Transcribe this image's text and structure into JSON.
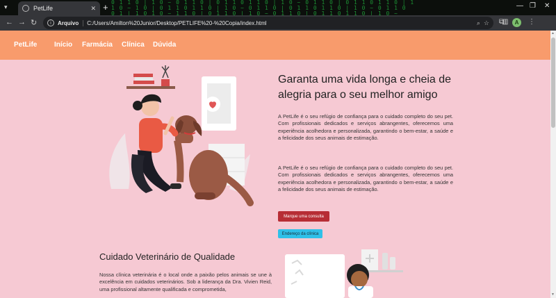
{
  "browser": {
    "tab_title": "PetLife",
    "url_chip": "Arquivo",
    "url": "C:/Users/Amilton%20Junior/Desktop/PETLIFE%20-%20Copia/index.html"
  },
  "site": {
    "brand": "PetLife",
    "nav": [
      "Início",
      "Farmácia",
      "Clínica",
      "Dúvida"
    ],
    "nav_color": "#f89b6c",
    "bg_color": "#f6c9d3"
  },
  "hero": {
    "title": "Garanta uma vida longa e cheia de alegria para o seu melhor amigo",
    "paragraph_1": "A PetLife é o seu refúgio de confiança para o cuidado completo do seu pet. Com profissionais dedicados e serviços abrangentes, oferecemos uma experiência acolhedora e personalizada, garantindo o bem-estar, a saúde e a felicidade dos seus animais de estimação.",
    "paragraph_2": "A PetLife é o seu refúgio de confiança para o cuidado completo do seu pet. Com profissionais dedicados e serviços abrangentes, oferecemos uma experiência acolhedora e personalizada, garantindo o bem-estar, a saúde e a felicidade dos seus animais de estimação.",
    "button_primary": "Marque uma consulta",
    "button_secondary": "Endereço da clínica"
  },
  "section": {
    "title": "Cuidado Veterinário de Qualidade",
    "paragraph": "Nossa clínica veterinária é o local onde a paixão pelos animais se une à excelência em cuidados veterinários. Sob a liderança da Dra. Vivien Reid, uma profissional altamente qualificada e comprometida,"
  },
  "icons": {
    "back": "arrow-left-icon",
    "forward": "arrow-right-icon",
    "reload": "reload-icon",
    "info": "info-icon",
    "zoom": "zoom-icon",
    "star": "bookmark-star-icon",
    "extensions": "extensions-icon",
    "sidepanel": "side-panel-icon",
    "menu": "kebab-menu-icon"
  }
}
